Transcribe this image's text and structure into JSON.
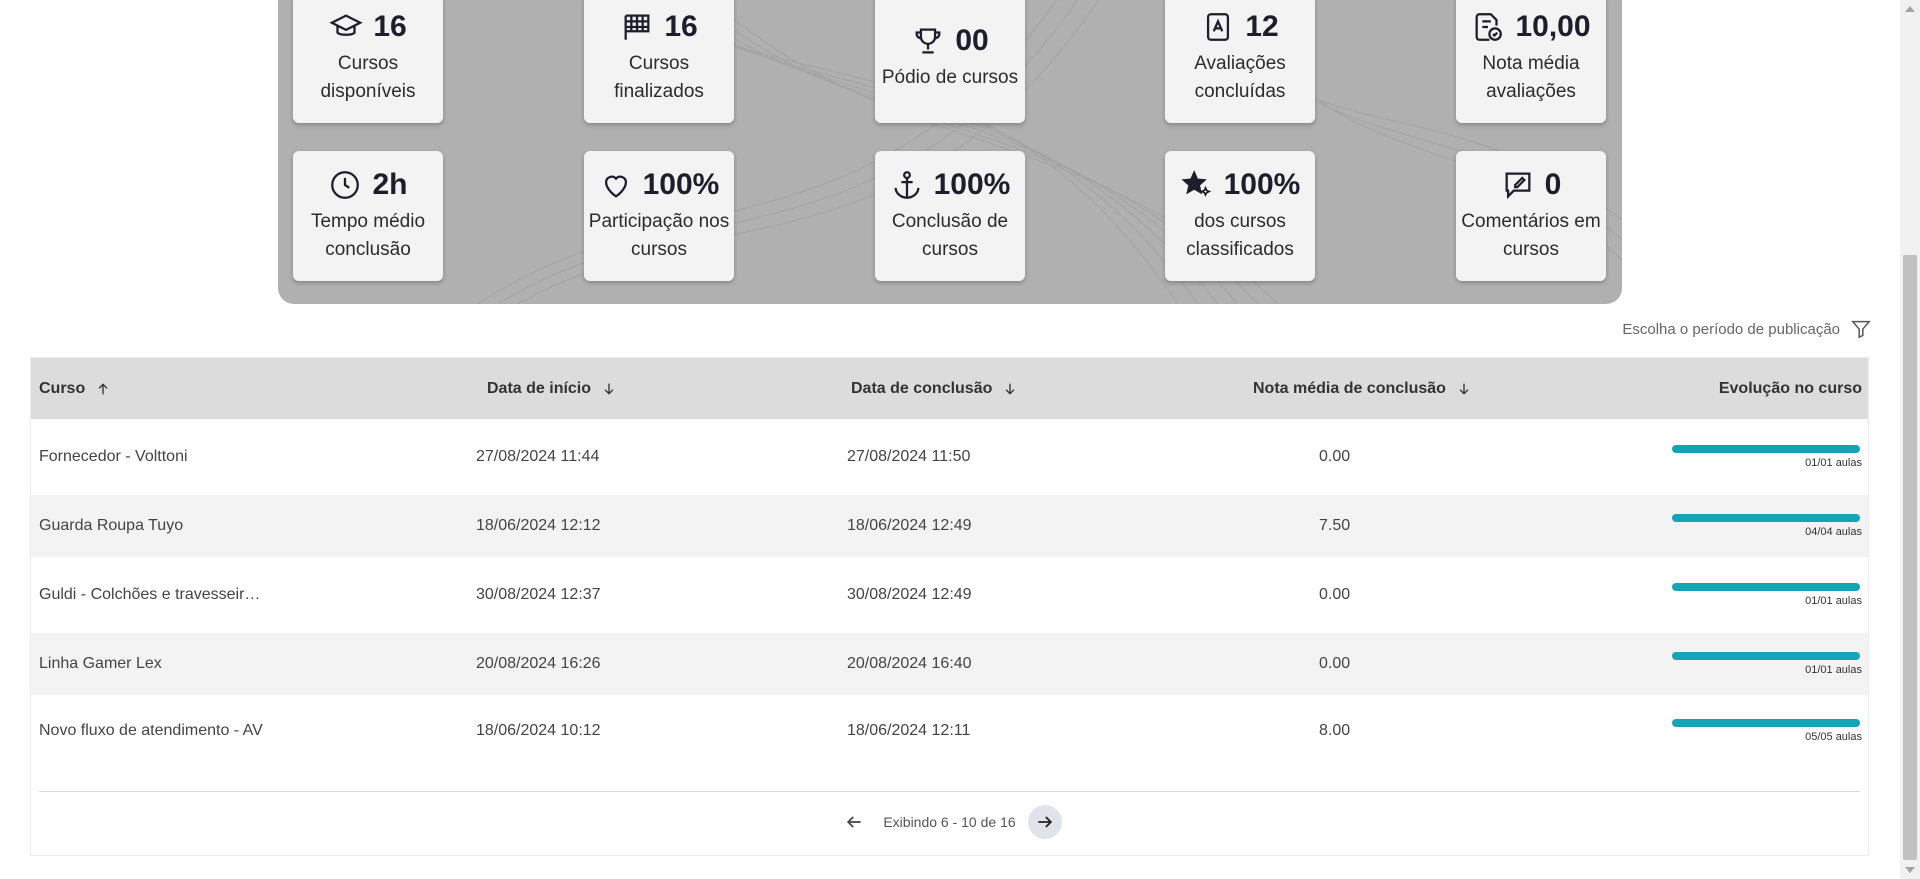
{
  "stats": {
    "cards": [
      {
        "icon": "graduation-cap-icon",
        "value": "16",
        "label": "Cursos disponíveis"
      },
      {
        "icon": "checkered-flag-icon",
        "value": "16",
        "label": "Cursos finalizados"
      },
      {
        "icon": "trophy-icon",
        "value": "00",
        "label": "Pódio de cursos"
      },
      {
        "icon": "evaluation-doc-icon",
        "value": "12",
        "label": "Avaliações concluídas"
      },
      {
        "icon": "graded-doc-icon",
        "value": "10,00",
        "label": "Nota média avaliações"
      },
      {
        "icon": "clock-icon",
        "value": "2h",
        "label": "Tempo médio conclusão"
      },
      {
        "icon": "heart-icon",
        "value": "100%",
        "label": "Participação nos cursos"
      },
      {
        "icon": "anchor-icon",
        "value": "100%",
        "label": "Conclusão de cursos"
      },
      {
        "icon": "star-sparkle-icon",
        "value": "100%",
        "label": "dos cursos classificados"
      },
      {
        "icon": "comment-edit-icon",
        "value": "0",
        "label": "Comentários em cursos"
      }
    ]
  },
  "filter": {
    "label": "Escolha o período de publicação",
    "icon": "filter-icon"
  },
  "table": {
    "headers": {
      "course": "Curso",
      "start": "Data de início",
      "end": "Data de conclusão",
      "grade": "Nota média de conclusão",
      "progress": "Evolução no curso"
    },
    "rows": [
      {
        "course": "Fornecedor - Volttoni",
        "start": "27/08/2024 11:44",
        "end": "27/08/2024 11:50",
        "grade": "0.00",
        "progress": 1.0,
        "aulas": "01/01 aulas"
      },
      {
        "course": "Guarda Roupa Tuyo",
        "start": "18/06/2024 12:12",
        "end": "18/06/2024 12:49",
        "grade": "7.50",
        "progress": 1.0,
        "aulas": "04/04 aulas"
      },
      {
        "course": "Guldi - Colchões e travesseir…",
        "start": "30/08/2024 12:37",
        "end": "30/08/2024 12:49",
        "grade": "0.00",
        "progress": 1.0,
        "aulas": "01/01 aulas"
      },
      {
        "course": "Linha Gamer Lex",
        "start": "20/08/2024 16:26",
        "end": "20/08/2024 16:40",
        "grade": "0.00",
        "progress": 1.0,
        "aulas": "01/01 aulas"
      },
      {
        "course": "Novo fluxo de atendimento - AV",
        "start": "18/06/2024 10:12",
        "end": "18/06/2024 12:11",
        "grade": "8.00",
        "progress": 1.0,
        "aulas": "05/05 aulas"
      }
    ]
  },
  "pagination": {
    "label": "Exibindo 6 - 10 de 16"
  },
  "colors": {
    "accent": "#16a3b6",
    "panel": "#b0b0b0"
  }
}
